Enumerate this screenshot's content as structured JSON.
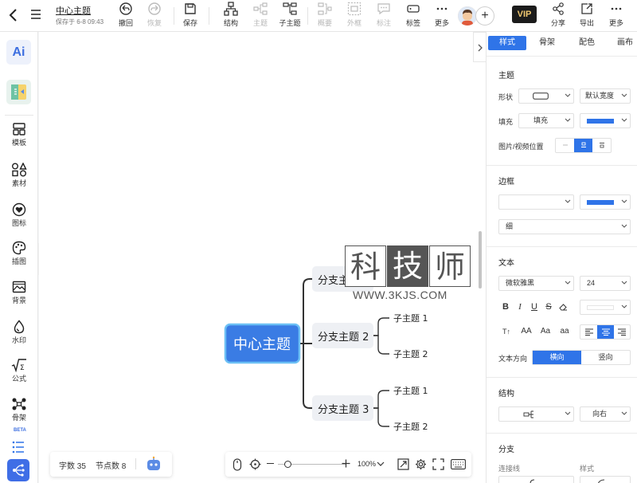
{
  "document": {
    "title": "中心主题",
    "saved_status": "保存于 6-8 09:43"
  },
  "toolbar": {
    "undo": "撤回",
    "redo": "恢复",
    "save": "保存",
    "structure": "结构",
    "topic": "主题",
    "subtopic": "子主题",
    "summary": "概要",
    "frame": "外框",
    "note": "标注",
    "tag": "标签",
    "more": "更多",
    "vip": "VIP",
    "share": "分享",
    "export": "导出",
    "more_right": "更多"
  },
  "sidebar": {
    "ai": "Ai",
    "items": [
      {
        "label": "模板",
        "icon": "template-icon"
      },
      {
        "label": "素材",
        "icon": "shapes-icon"
      },
      {
        "label": "图标",
        "icon": "heart-icon"
      },
      {
        "label": "插图",
        "icon": "palette-icon"
      },
      {
        "label": "背景",
        "icon": "image-icon"
      },
      {
        "label": "水印",
        "icon": "droplet-icon"
      },
      {
        "label": "公式",
        "icon": "formula-icon"
      },
      {
        "label": "骨架",
        "icon": "skeleton-icon"
      }
    ],
    "beta": "BETA"
  },
  "mindmap": {
    "center": "中心主题",
    "branches": [
      {
        "label": "分支主题 1",
        "children": []
      },
      {
        "label": "分支主题 2",
        "children": [
          "子主题 1",
          "子主题 2"
        ]
      },
      {
        "label": "分支主题 3",
        "children": [
          "子主题 1",
          "子主题 2"
        ]
      }
    ]
  },
  "watermark": {
    "chars": [
      "科",
      "技",
      "师"
    ],
    "url": "WWW.3KJS.COM"
  },
  "status": {
    "word_count": "字数 35",
    "node_count": "节点数 8",
    "zoom": "100%"
  },
  "right_panel": {
    "tabs": [
      "样式",
      "骨架",
      "配色",
      "画布"
    ],
    "active_tab": 0,
    "topic": {
      "title": "主题",
      "shape_label": "形状",
      "width_value": "默认宽度",
      "fill_label": "填充",
      "fill_value": "填充",
      "image_pos_label": "图片/视频位置"
    },
    "border": {
      "title": "边框",
      "thickness": "细"
    },
    "text": {
      "title": "文本",
      "font": "微软雅黑",
      "size": "24",
      "case_options": [
        "T↑",
        "AA",
        "Aa",
        "aa"
      ],
      "direction_label": "文本方向",
      "horizontal": "横向",
      "vertical": "竖向"
    },
    "structure": {
      "title": "结构",
      "direction": "向右"
    },
    "branch": {
      "title": "分支",
      "connector_label": "连接线",
      "style_label": "样式"
    }
  },
  "colors": {
    "accent": "#2f74e8",
    "center_node": "#3a7ce4",
    "branch_fill": "#eef0f4",
    "line": "#333333"
  }
}
